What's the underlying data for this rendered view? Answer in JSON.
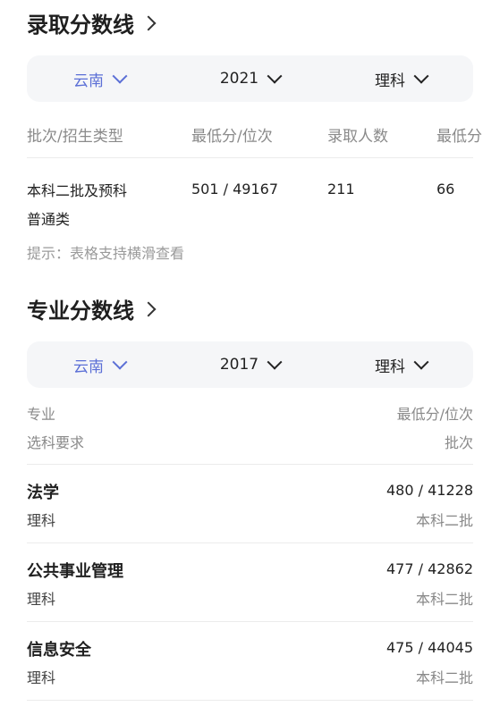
{
  "admission": {
    "title": "录取分数线",
    "filters": {
      "province": "云南",
      "year": "2021",
      "subject": "理科"
    },
    "columns": [
      "批次/招生类型",
      "最低分/位次",
      "录取人数",
      "最低分"
    ],
    "row": {
      "batch_line1": "本科二批及预科",
      "batch_line2": "普通类",
      "score_rank": "501 / 49167",
      "count": "211",
      "min_diff": "66"
    },
    "tip": "提示：表格支持横滑查看"
  },
  "major": {
    "title": "专业分数线",
    "filters": {
      "province": "云南",
      "year": "2017",
      "subject": "理科"
    },
    "header": {
      "major_label": "专业",
      "req_label": "选科要求",
      "score_label": "最低分/位次",
      "batch_label": "批次"
    },
    "rows": [
      {
        "name": "法学",
        "subject": "理科",
        "score": "480 / 41228",
        "batch": "本科二批"
      },
      {
        "name": "公共事业管理",
        "subject": "理科",
        "score": "477 / 42862",
        "batch": "本科二批"
      },
      {
        "name": "信息安全",
        "subject": "理科",
        "score": "475 / 44045",
        "batch": "本科二批"
      }
    ]
  },
  "colors": {
    "accent": "#5b6fd6",
    "muted": "#8a8a8a",
    "bar_bg": "#f5f6f8"
  }
}
